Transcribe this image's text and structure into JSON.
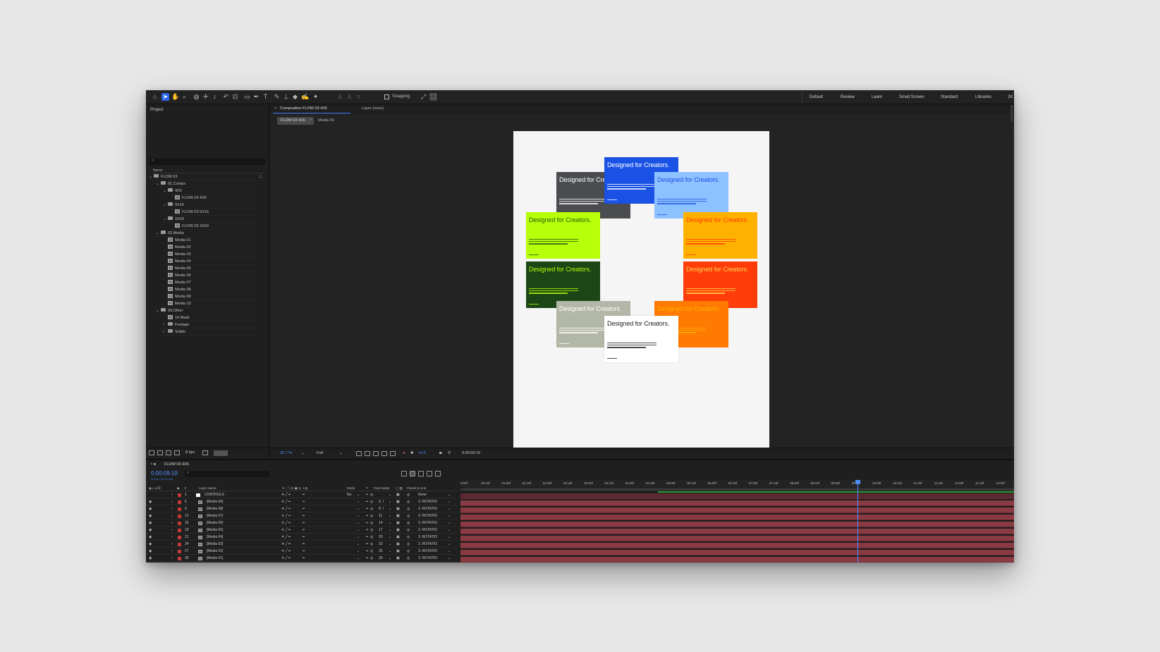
{
  "toolbar": {
    "snapping_label": "Snapping",
    "workspaces": [
      "Default",
      "Review",
      "Learn",
      "Small Screen",
      "Standard",
      "Libraries",
      "2K"
    ]
  },
  "project": {
    "title": "Project",
    "column_name": "Name",
    "tree": [
      {
        "label": "FLOW 03",
        "type": "folder",
        "depth": 0,
        "expanded": true
      },
      {
        "label": "01.Comps",
        "type": "folder",
        "depth": 1,
        "expanded": true
      },
      {
        "label": "4X5",
        "type": "folder",
        "depth": 2,
        "expanded": true
      },
      {
        "label": "FLOW 03 4X5",
        "type": "comp",
        "depth": 3
      },
      {
        "label": "9X16",
        "type": "folder",
        "depth": 2,
        "expanded": true
      },
      {
        "label": "FLOW 03 9X16",
        "type": "comp",
        "depth": 3
      },
      {
        "label": "16X9",
        "type": "folder",
        "depth": 2,
        "expanded": true
      },
      {
        "label": "FLOW 03 16X9",
        "type": "comp",
        "depth": 3
      },
      {
        "label": "02.Media",
        "type": "folder",
        "depth": 1,
        "expanded": true
      },
      {
        "label": "Media 01",
        "type": "comp",
        "depth": 2
      },
      {
        "label": "Media 02",
        "type": "comp",
        "depth": 2
      },
      {
        "label": "Media 03",
        "type": "comp",
        "depth": 2
      },
      {
        "label": "Media 04",
        "type": "comp",
        "depth": 2
      },
      {
        "label": "Media 05",
        "type": "comp",
        "depth": 2
      },
      {
        "label": "Media 06",
        "type": "comp",
        "depth": 2
      },
      {
        "label": "Media 07",
        "type": "comp",
        "depth": 2
      },
      {
        "label": "Media 08",
        "type": "comp",
        "depth": 2
      },
      {
        "label": "Media 09",
        "type": "comp",
        "depth": 2
      },
      {
        "label": "Media 10",
        "type": "comp",
        "depth": 2
      },
      {
        "label": "03.Other",
        "type": "folder",
        "depth": 1,
        "expanded": true
      },
      {
        "label": "10 Mask",
        "type": "comp",
        "depth": 2
      },
      {
        "label": "Footage",
        "type": "folder",
        "depth": 2,
        "expanded": false
      },
      {
        "label": "Solids",
        "type": "folder",
        "depth": 2,
        "expanded": false
      }
    ],
    "bpc": "8 bpc"
  },
  "viewer": {
    "tab_label": "Composition FLOW 03 4X5",
    "layer_tab": "Layer (none)",
    "breadcrumb_active": "FLOW 03 4X5",
    "breadcrumb_next": "Media 09",
    "zoom": "30.7 %",
    "resolution": "Full",
    "exposure": "+0.0",
    "timecode": "0:00:09:19",
    "card_title": "Designed for Creators.",
    "cards": [
      {
        "bg": "#1a52e6",
        "fg": "#ffffff"
      },
      {
        "bg": "#4a4c50",
        "fg": "#ffffff"
      },
      {
        "bg": "#8ec1ff",
        "fg": "#1a52e6"
      },
      {
        "bg": "#b8ff0a",
        "fg": "#2b5a0e"
      },
      {
        "bg": "#ffb100",
        "fg": "#ff3c00"
      },
      {
        "bg": "#1d4616",
        "fg": "#b8ff0a"
      },
      {
        "bg": "#ff3c0a",
        "fg": "#ffd54a"
      },
      {
        "bg": "#ff7a00",
        "fg": "#ffb100"
      },
      {
        "bg": "#b3b7a8",
        "fg": "#ffffff"
      },
      {
        "bg": "#ffffff",
        "fg": "#1e1e1e"
      }
    ]
  },
  "timeline": {
    "tab_label": "FLOW 03 4X5",
    "timecode": "0:00:09:19",
    "subtime": "00295 (30.00 fps)",
    "headers": {
      "layer_name": "Layer Name",
      "mode": "Mode",
      "t": "T",
      "track_matte": "Track Matte",
      "parent": "Parent & Link"
    },
    "ruler_ticks": [
      "0:00f",
      "00:15f",
      "01:00f",
      "01:15f",
      "02:00f",
      "02:15f",
      "03:00f",
      "03:15f",
      "04:00f",
      "04:15f",
      "05:00f",
      "05:15f",
      "06:00f",
      "06:15f",
      "07:00f",
      "07:15f",
      "08:00f",
      "08:15f",
      "09:00f",
      "09:15f",
      "10:00f",
      "10:15f",
      "11:00f",
      "11:15f",
      "12:00f",
      "12:15f",
      "13:00f"
    ],
    "layers": [
      {
        "num": "1",
        "name": "CONTROLS",
        "mode": "No",
        "matte": "",
        "parent": "None"
      },
      {
        "num": "6",
        "name": "[Media 09]",
        "mode": "",
        "matte": "5. I",
        "parent": "3. ROTATIO"
      },
      {
        "num": "9",
        "name": "[Media 08]",
        "mode": "",
        "matte": "8. I",
        "parent": "3. ROTATIO"
      },
      {
        "num": "12",
        "name": "[Media 07]",
        "mode": "",
        "matte": "11",
        "parent": "3. ROTATIO"
      },
      {
        "num": "15",
        "name": "[Media 06]",
        "mode": "",
        "matte": "14",
        "parent": "3. ROTATIO"
      },
      {
        "num": "18",
        "name": "[Media 05]",
        "mode": "",
        "matte": "17",
        "parent": "3. ROTATIO"
      },
      {
        "num": "21",
        "name": "[Media 04]",
        "mode": "",
        "matte": "20",
        "parent": "3. ROTATIO"
      },
      {
        "num": "24",
        "name": "[Media 03]",
        "mode": "",
        "matte": "23",
        "parent": "3. ROTATIO"
      },
      {
        "num": "27",
        "name": "[Media 02]",
        "mode": "",
        "matte": "26",
        "parent": "3. ROTATIO"
      },
      {
        "num": "30",
        "name": "[Media 01]",
        "mode": "",
        "matte": "29",
        "parent": "3. ROTATIO"
      }
    ]
  }
}
